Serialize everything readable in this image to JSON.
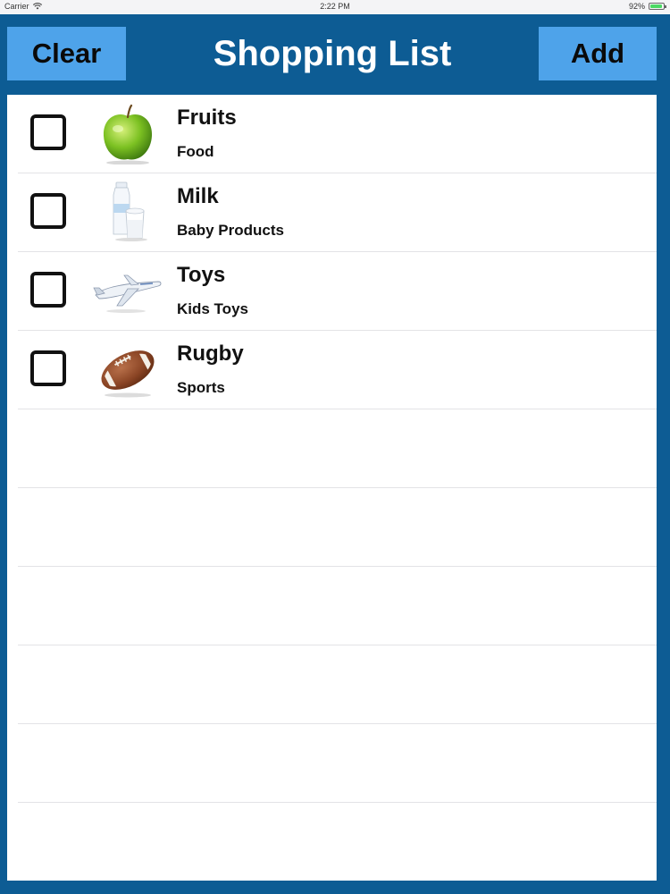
{
  "status_bar": {
    "carrier": "Carrier",
    "time": "2:22 PM",
    "battery": "92%",
    "battery_level": 0.92
  },
  "nav": {
    "clear_label": "Clear",
    "title": "Shopping List",
    "add_label": "Add"
  },
  "colors": {
    "nav_background": "#0d5c94",
    "button_background": "#4ea3ea",
    "title_text": "#ffffff"
  },
  "items": [
    {
      "title": "Fruits",
      "category": "Food",
      "icon": "apple-icon",
      "checked": false
    },
    {
      "title": "Milk",
      "category": "Baby Products",
      "icon": "milk-icon",
      "checked": false
    },
    {
      "title": "Toys",
      "category": "Kids Toys",
      "icon": "airplane-icon",
      "checked": false
    },
    {
      "title": "Rugby",
      "category": "Sports",
      "icon": "rugby-ball-icon",
      "checked": false
    }
  ]
}
